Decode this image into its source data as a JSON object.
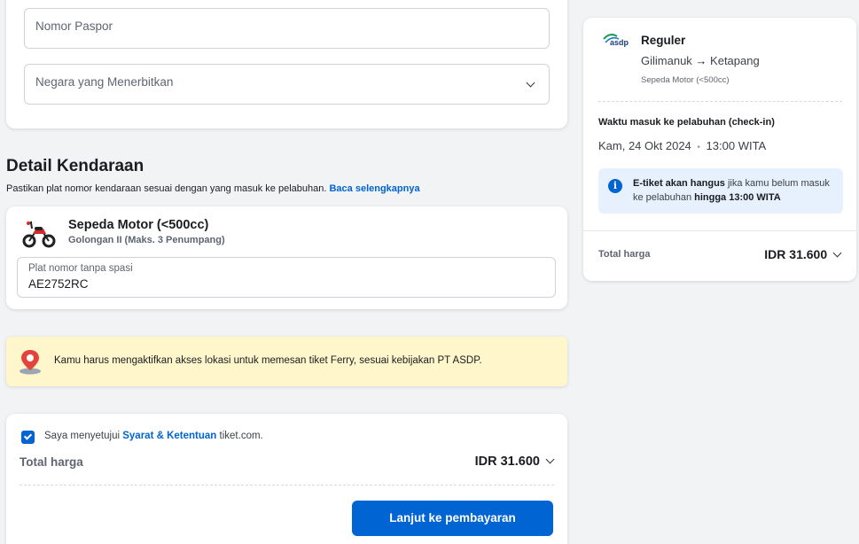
{
  "passport": {
    "number_placeholder": "Nomor Paspor",
    "country_placeholder": "Negara yang Menerbitkan"
  },
  "vehicle": {
    "section_title": "Detail Kendaraan",
    "notice_text": "Pastikan plat nomor kendaraan sesuai dengan yang masuk ke pelabuhan.",
    "notice_link": "Baca selengkapnya",
    "name": "Sepeda Motor (<500cc)",
    "class": "Golongan II (Maks. 3 Penumpang)",
    "plate_label": "Plat nomor tanpa spasi",
    "plate_value": "AE2752RC"
  },
  "location_alert": {
    "text": "Kamu harus mengaktifkan akses lokasi untuk memesan tiket Ferry, sesuai kebijakan PT ASDP."
  },
  "agreement": {
    "prefix": "Saya menyetujui",
    "link": "Syarat & Ketentuan",
    "suffix": "tiket.com.",
    "checked": true
  },
  "bottom_total": {
    "label": "Total harga",
    "value": "IDR 31.600"
  },
  "pay_button": "Lanjut ke pembayaran",
  "summary": {
    "operator_logo": "asdp",
    "service": "Reguler",
    "origin": "Gilimanuk",
    "arrow": "→",
    "destination": "Ketapang",
    "vehicle": "Sepeda Motor (<500cc)",
    "checkin_label": "Waktu masuk ke pelabuhan (check-in)",
    "checkin_date": "Kam, 24 Okt 2024",
    "checkin_sep": "•",
    "checkin_time": "13:00 WITA",
    "info_bold1": "E-tiket akan hangus",
    "info_text1": " jika kamu belum masuk ke pelabuhan ",
    "info_bold2": "hingga 13:00 WITA",
    "total_label": "Total harga",
    "total_value": "IDR 31.600"
  },
  "colors": {
    "brand_blue": "#0064d2",
    "alert_yellow": "#fff6cc",
    "info_blue_bg": "#e6f1fd",
    "page_bg": "#f2f3f5"
  }
}
